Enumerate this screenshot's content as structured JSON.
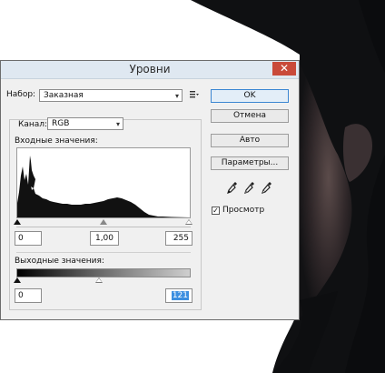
{
  "dialog": {
    "title": "Уровни",
    "close_glyph": "✕",
    "preset": {
      "label": "Набор:",
      "value": "Заказная",
      "menu_icon": "list-menu-icon"
    },
    "channel": {
      "label": "Канал:",
      "value": "RGB"
    },
    "input_levels": {
      "label": "Входные значения:",
      "black": "0",
      "gamma": "1,00",
      "white": "255"
    },
    "output_levels": {
      "label": "Выходные значения:",
      "black": "0",
      "white": "121"
    },
    "buttons": {
      "ok": "OK",
      "cancel": "Отмена",
      "auto": "Авто",
      "options": "Параметры..."
    },
    "preview": {
      "label": "Просмотр",
      "checked": true,
      "check_glyph": "✓"
    },
    "eyedroppers": [
      "black-eyedropper-icon",
      "gray-eyedropper-icon",
      "white-eyedropper-icon"
    ],
    "colors": {
      "titlebar": "#dfe8f1",
      "close": "#c94a3a",
      "accent": "#3b86d2"
    }
  }
}
